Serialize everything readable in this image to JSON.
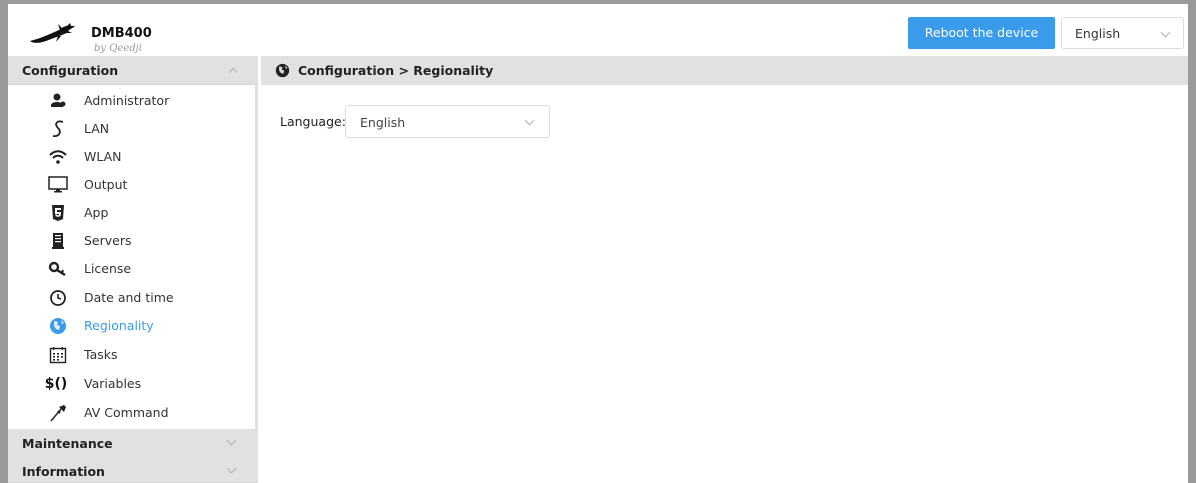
{
  "header": {
    "app_name": "DMB400",
    "app_sub": "by Qeedji",
    "reboot_label": "Reboot the device",
    "language_value": "English"
  },
  "sidebar": {
    "sections": [
      {
        "label": "Configuration",
        "expanded": true
      },
      {
        "label": "Maintenance",
        "expanded": false
      },
      {
        "label": "Information",
        "expanded": false
      }
    ],
    "items": [
      {
        "label": "Administrator",
        "icon": "administrator-icon"
      },
      {
        "label": "LAN",
        "icon": "lan-icon"
      },
      {
        "label": "WLAN",
        "icon": "wifi-icon"
      },
      {
        "label": "Output",
        "icon": "monitor-icon"
      },
      {
        "label": "App",
        "icon": "html5-icon"
      },
      {
        "label": "Servers",
        "icon": "server-icon"
      },
      {
        "label": "License",
        "icon": "key-icon"
      },
      {
        "label": "Date and time",
        "icon": "clock-icon"
      },
      {
        "label": "Regionality",
        "icon": "globe-icon",
        "active": true
      },
      {
        "label": "Tasks",
        "icon": "calendar-icon"
      },
      {
        "label": "Variables",
        "icon": "variables-icon",
        "icon_text": "$()"
      },
      {
        "label": "AV Command",
        "icon": "av-command-icon"
      }
    ]
  },
  "main": {
    "breadcrumb": "Configuration > Regionality",
    "language_label": "Language:",
    "language_value": "English"
  },
  "colors": {
    "accent": "#3a9bea",
    "section_bg": "#e1e1e1",
    "frame": "#9a9a9a"
  }
}
